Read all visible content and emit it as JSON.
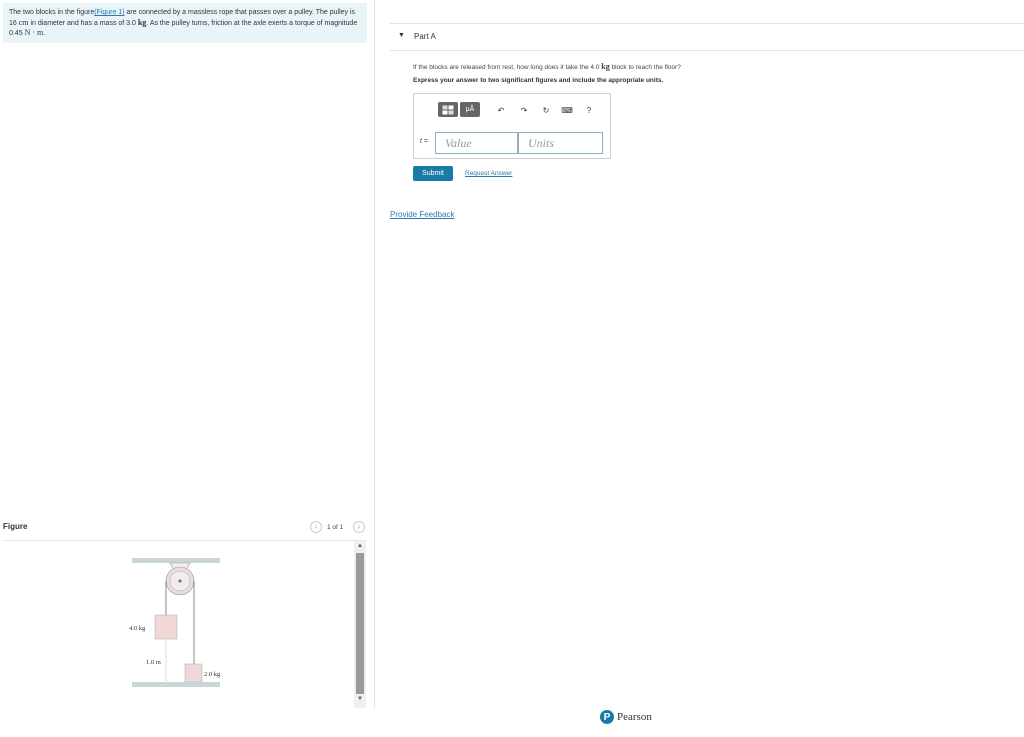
{
  "problem": {
    "text_before_link": "The two blocks in the figure",
    "link": "(Figure 1)",
    "text_after_link": " are connected by a massless rope that passes over a pulley. The pulley is 16 ",
    "unit_cm": "cm",
    "text_mid": " in diameter and has a mass of 3.0 ",
    "unit_kg": "kg",
    "text_mid2": ". As the pulley turns, friction at the axle exerts a torque of magnitude 0.45 ",
    "unit_torque": "N · m",
    "text_end": "."
  },
  "part": {
    "title": "Part A",
    "question_before": "If the blocks are released from rest, how long does it take the 4.0 ",
    "question_unit": "kg",
    "question_after": " block to reach the floor?",
    "instruction": "Express your answer to two significant figures and include the appropriate units."
  },
  "toolbar": {
    "templates_label": "",
    "units_label": "μÅ",
    "undo": "↶",
    "redo": "↷",
    "reset": "↻",
    "keyboard": "⌨",
    "help": "?"
  },
  "answer": {
    "variable": "t =",
    "value_placeholder": "Value",
    "units_placeholder": "Units"
  },
  "buttons": {
    "submit": "Submit",
    "request_answer": "Request Answer",
    "provide_feedback": "Provide Feedback"
  },
  "figure": {
    "title": "Figure",
    "pager": "1 of 1",
    "mass_left": "4.0 kg",
    "mass_right": "2.0 kg",
    "height": "1.0 m"
  },
  "footer": {
    "brand_letter": "P",
    "brand": "Pearson"
  },
  "colors": {
    "accent": "#1a7ba8",
    "link": "#2a7ab0",
    "problem_bg": "#e8f4f8"
  }
}
